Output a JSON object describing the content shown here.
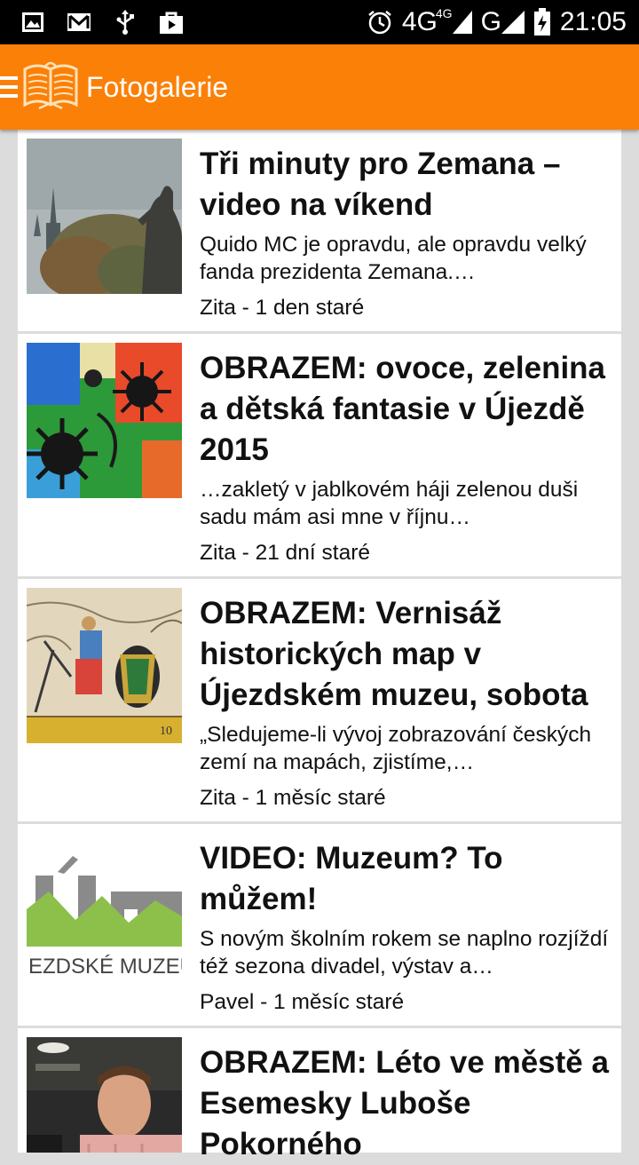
{
  "status_bar": {
    "time": "21:05",
    "network_primary": "4G",
    "network_secondary": "4G",
    "network_tertiary": "G",
    "icons": [
      "image-icon",
      "gmail-icon",
      "usb-icon",
      "bag-icon",
      "alarm-icon",
      "signal-icon",
      "battery-icon"
    ]
  },
  "app_bar": {
    "title": "Fotogalerie",
    "menu_icon": "hamburger-menu-icon",
    "logo_icon": "book-logo-icon",
    "color": "#fb8008"
  },
  "articles": [
    {
      "title": "Tři minuty pro Zemana – video na víkend",
      "excerpt": "Quido MC je opravdu, ale opravdu velký fanda prezidenta Zemana.…",
      "meta": "Zita - 1 den staré"
    },
    {
      "title": "OBRAZEM: ovoce, zelenina a dětská fantasie v Újezdě 2015",
      "excerpt": "…zakletý v jablkovém háji zelenou duši sadu mám asi mne v říjnu…",
      "meta": "Zita - 21 dní staré"
    },
    {
      "title": "OBRAZEM: Vernisáž historických map v Újezdském muzeu, sobota",
      "excerpt": "„Sledujeme-li vývoj zobrazování českých zemí na mapách, zjistíme,…",
      "meta": "Zita - 1 měsíc staré"
    },
    {
      "title": "VIDEO: Muzeum? To můžem!",
      "excerpt": "S novým školním rokem se naplno rozjíždí též sezona divadel, výstav a…",
      "meta": "Pavel - 1 měsíc staré",
      "logo_text": "EZDSKÉ MUZEU"
    },
    {
      "title": "OBRAZEM: Léto ve městě a Esemesky Luboše Pokorného",
      "excerpt": "",
      "meta": ""
    }
  ]
}
